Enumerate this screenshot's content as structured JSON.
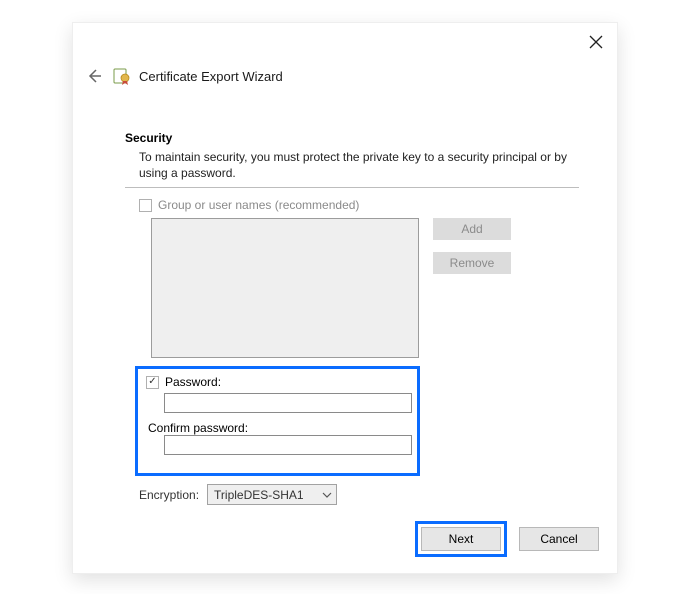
{
  "title": "Certificate Export Wizard",
  "section": {
    "heading": "Security",
    "description": "To maintain security, you must protect the private key to a security principal or by using a password."
  },
  "group": {
    "checkbox_label": "Group or user names (recommended)",
    "checked": false,
    "add_label": "Add",
    "remove_label": "Remove"
  },
  "password": {
    "checked": true,
    "label": "Password:",
    "confirm_label": "Confirm password:",
    "value": "",
    "confirm_value": ""
  },
  "encryption": {
    "label": "Encryption:",
    "value": "TripleDES-SHA1"
  },
  "footer": {
    "next": "Next",
    "cancel": "Cancel"
  }
}
